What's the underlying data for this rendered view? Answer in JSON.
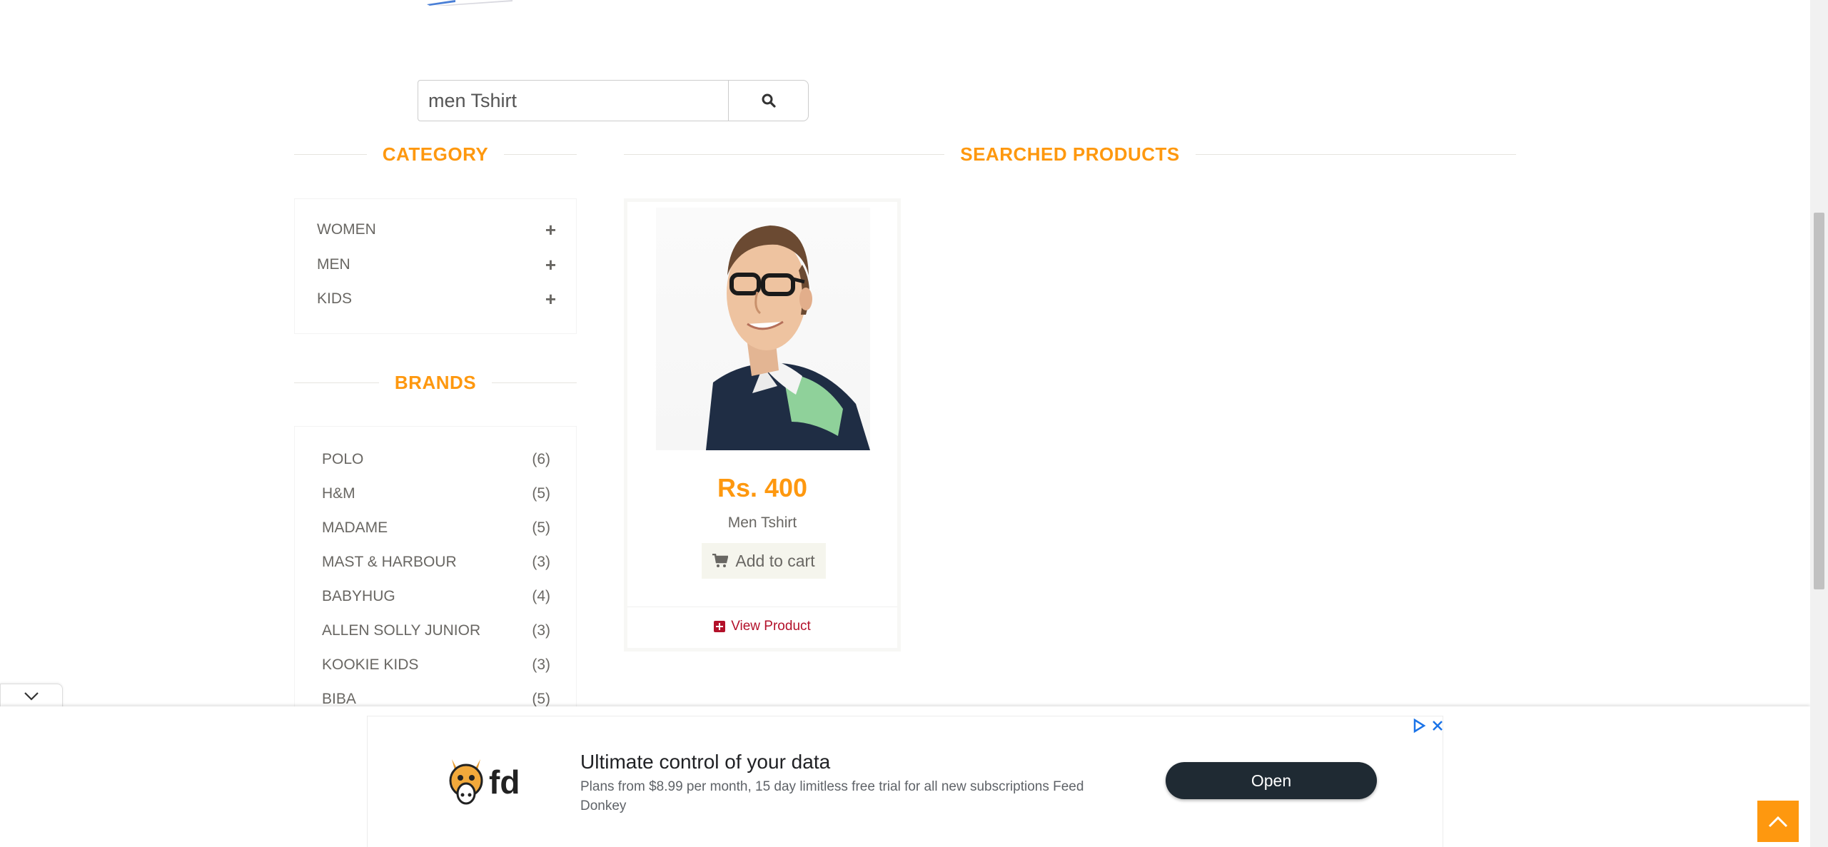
{
  "search": {
    "value": "men Tshirt",
    "button_icon": "search-icon"
  },
  "sidebar": {
    "category_title": "CATEGORY",
    "categories": [
      {
        "label": "WOMEN",
        "icon": "plus-icon"
      },
      {
        "label": "MEN",
        "icon": "plus-icon"
      },
      {
        "label": "KIDS",
        "icon": "plus-icon"
      }
    ],
    "brands_title": "BRANDS",
    "brands": [
      {
        "name": "POLO",
        "count": "(6)"
      },
      {
        "name": "H&M",
        "count": "(5)"
      },
      {
        "name": "MADAME",
        "count": "(5)"
      },
      {
        "name": "MAST & HARBOUR",
        "count": "(3)"
      },
      {
        "name": "BABYHUG",
        "count": "(4)"
      },
      {
        "name": "ALLEN SOLLY JUNIOR",
        "count": "(3)"
      },
      {
        "name": "KOOKIE KIDS",
        "count": "(3)"
      },
      {
        "name": "BIBA",
        "count": "(5)"
      }
    ]
  },
  "main": {
    "title": "SEARCHED PRODUCTS",
    "products": [
      {
        "price": "Rs. 400",
        "name": "Men Tshirt",
        "add_to_cart_label": "Add to cart",
        "view_product_label": "View Product"
      }
    ]
  },
  "ad": {
    "headline": "Ultimate control of your data",
    "body": "Plans from $8.99 per month, 15 day limitless free trial for all new subscriptions Feed Donkey",
    "logo_text": "fd",
    "cta_label": "Open"
  },
  "colors": {
    "accent": "#fe980f",
    "link": "#b3112a",
    "text": "#696763",
    "ad_button": "#1f2a33"
  }
}
